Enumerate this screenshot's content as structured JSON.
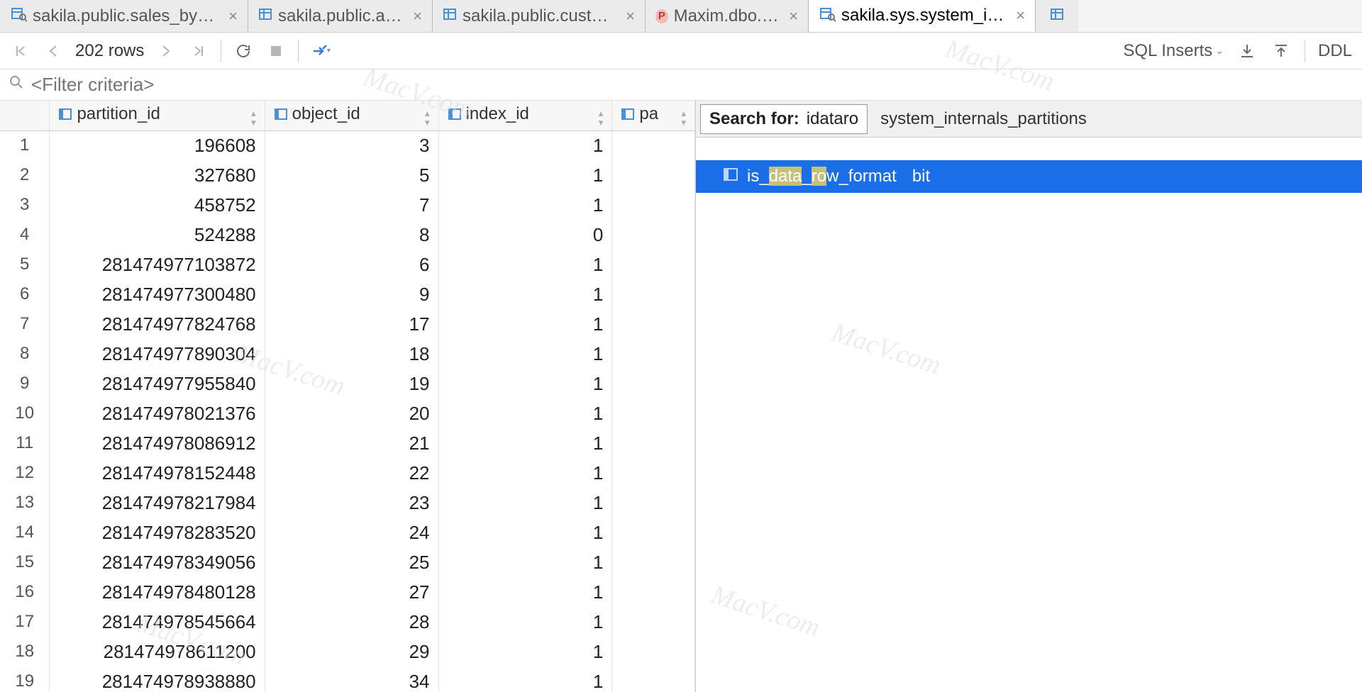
{
  "tabs": [
    {
      "label": "sakila.public.sales_by_film_c",
      "kind": "view",
      "active": false
    },
    {
      "label": "sakila.public.actor",
      "kind": "table",
      "active": false
    },
    {
      "label": "sakila.public.custome",
      "kind": "table",
      "active": false
    },
    {
      "label": "Maxim.dbo.Upd",
      "kind": "p",
      "active": false
    },
    {
      "label": "sakila.sys.system_internal",
      "kind": "view",
      "active": true
    }
  ],
  "toolbar": {
    "row_count": "202 rows",
    "export_label": "SQL Inserts",
    "ddl_label": "DDL"
  },
  "filter": {
    "placeholder": "<Filter criteria>"
  },
  "columns": [
    {
      "name": "partition_id"
    },
    {
      "name": "object_id"
    },
    {
      "name": "index_id"
    },
    {
      "name": "pa"
    }
  ],
  "rows": [
    {
      "partition_id": "196608",
      "object_id": "3",
      "index_id": "1"
    },
    {
      "partition_id": "327680",
      "object_id": "5",
      "index_id": "1"
    },
    {
      "partition_id": "458752",
      "object_id": "7",
      "index_id": "1"
    },
    {
      "partition_id": "524288",
      "object_id": "8",
      "index_id": "0"
    },
    {
      "partition_id": "281474977103872",
      "object_id": "6",
      "index_id": "1"
    },
    {
      "partition_id": "281474977300480",
      "object_id": "9",
      "index_id": "1"
    },
    {
      "partition_id": "281474977824768",
      "object_id": "17",
      "index_id": "1"
    },
    {
      "partition_id": "281474977890304",
      "object_id": "18",
      "index_id": "1"
    },
    {
      "partition_id": "281474977955840",
      "object_id": "19",
      "index_id": "1"
    },
    {
      "partition_id": "281474978021376",
      "object_id": "20",
      "index_id": "1"
    },
    {
      "partition_id": "281474978086912",
      "object_id": "21",
      "index_id": "1"
    },
    {
      "partition_id": "281474978152448",
      "object_id": "22",
      "index_id": "1"
    },
    {
      "partition_id": "281474978217984",
      "object_id": "23",
      "index_id": "1"
    },
    {
      "partition_id": "281474978283520",
      "object_id": "24",
      "index_id": "1"
    },
    {
      "partition_id": "281474978349056",
      "object_id": "25",
      "index_id": "1"
    },
    {
      "partition_id": "281474978480128",
      "object_id": "27",
      "index_id": "1"
    },
    {
      "partition_id": "281474978545664",
      "object_id": "28",
      "index_id": "1"
    },
    {
      "partition_id": "281474978611200",
      "object_id": "29",
      "index_id": "1"
    },
    {
      "partition_id": "281474978938880",
      "object_id": "34",
      "index_id": "1"
    }
  ],
  "search": {
    "label": "Search for:",
    "query": "idataro",
    "breadcrumb": "system_internals_partitions",
    "result_prefix": "is_",
    "result_hl1": "data",
    "result_mid": "_",
    "result_hl2": "ro",
    "result_suffix": "w_format",
    "result_type": "bit"
  },
  "watermarks": [
    "MacV.com",
    "MacV.com",
    "MacV.com",
    "MacV.com",
    "MacV.com",
    "MacV.com"
  ]
}
